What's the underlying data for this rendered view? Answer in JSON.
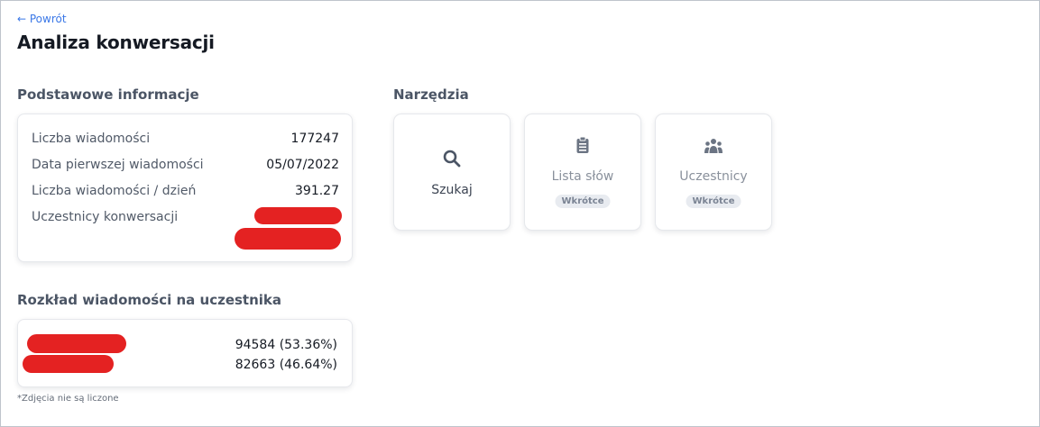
{
  "nav": {
    "back_label": "← Powrót"
  },
  "page": {
    "title": "Analiza konwersacji"
  },
  "basic_info": {
    "section_title": "Podstawowe informacje",
    "rows": [
      {
        "label": "Liczba wiadomości",
        "value": "177247"
      },
      {
        "label": "Data pierwszej wiadomości",
        "value": "05/07/2022"
      },
      {
        "label": "Liczba wiadomości / dzień",
        "value": "391.27"
      },
      {
        "label": "Uczestnicy konwersacji",
        "value": ""
      }
    ]
  },
  "tools": {
    "section_title": "Narzędzia",
    "items": [
      {
        "label": "Szukaj",
        "icon": "search-icon",
        "badge": ""
      },
      {
        "label": "Lista słów",
        "icon": "clipboard-list-icon",
        "badge": "Wkrótce"
      },
      {
        "label": "Uczestnicy",
        "icon": "users-icon",
        "badge": "Wkrótce"
      }
    ]
  },
  "distribution": {
    "section_title": "Rozkład wiadomości na uczestnika",
    "rows": [
      {
        "value": "94584 (53.36%)"
      },
      {
        "value": "82663 (46.64%)"
      }
    ],
    "footnote": "*Zdjęcia nie są liczone"
  },
  "colors": {
    "accent_link": "#3b78e7",
    "redaction": "#e42222",
    "badge_bg": "#e8ebf0"
  }
}
